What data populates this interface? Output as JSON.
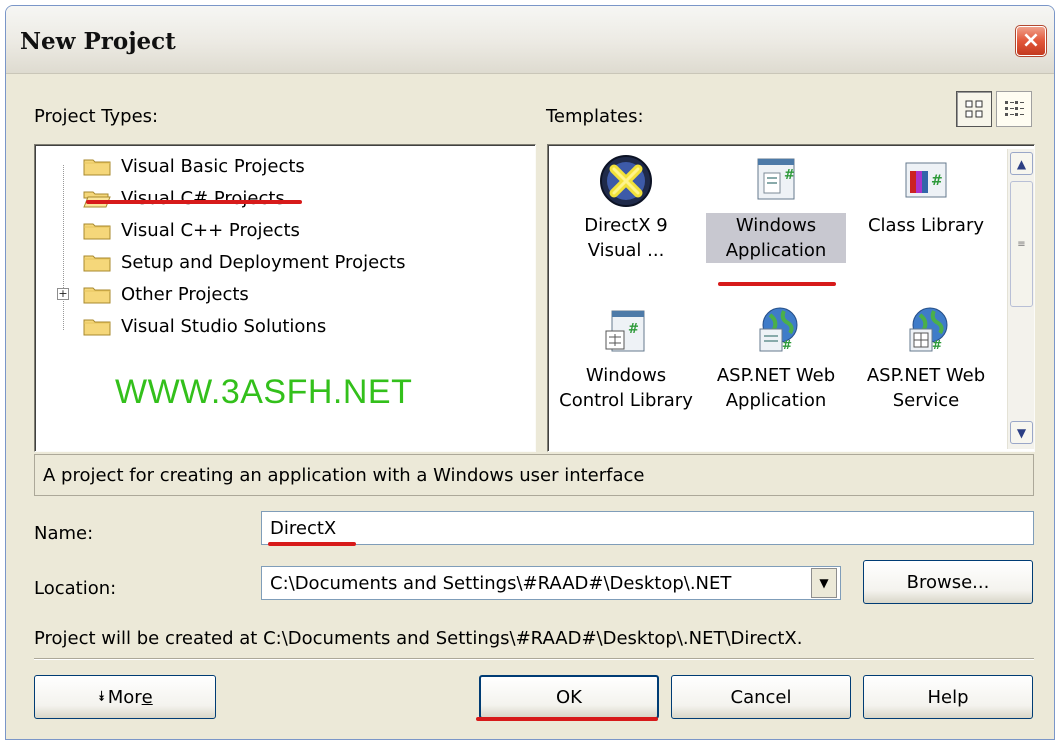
{
  "window": {
    "title": "New Project",
    "close_glyph": "×"
  },
  "project_types": {
    "label": "Project Types:",
    "items": [
      {
        "label": "Visual Basic Projects",
        "icon": "folder-icon",
        "selected": false
      },
      {
        "label": "Visual C# Projects",
        "icon": "folder-open-icon",
        "selected": true
      },
      {
        "label": "Visual C++ Projects",
        "icon": "folder-icon",
        "selected": false
      },
      {
        "label": "Setup and Deployment Projects",
        "icon": "folder-icon",
        "selected": false
      },
      {
        "label": "Other Projects",
        "icon": "folder-icon",
        "selected": false,
        "expander": "+"
      },
      {
        "label": "Visual Studio Solutions",
        "icon": "folder-icon",
        "selected": false
      }
    ],
    "watermark": "WWW.3ASFH.NET"
  },
  "templates": {
    "label": "Templates:",
    "view_buttons": [
      {
        "name": "large-icons-view",
        "icon": "large-icons-view-icon",
        "active": true
      },
      {
        "name": "small-icons-view",
        "icon": "small-icons-view-icon",
        "active": false
      }
    ],
    "items": [
      {
        "line1": "DirectX 9",
        "line2": "Visual ...",
        "icon": "directx-icon",
        "selected": false
      },
      {
        "line1": "Windows",
        "line2": "Application",
        "icon": "windows-application-icon",
        "selected": true
      },
      {
        "line1": "Class Library",
        "line2": "",
        "icon": "class-library-icon",
        "selected": false
      },
      {
        "line1": "Windows",
        "line2": "Control Library",
        "icon": "windows-control-library-icon",
        "selected": false
      },
      {
        "line1": "ASP.NET Web",
        "line2": "Application",
        "icon": "aspnet-web-application-icon",
        "selected": false
      },
      {
        "line1": "ASP.NET Web",
        "line2": "Service",
        "icon": "aspnet-web-service-icon",
        "selected": false
      }
    ],
    "scroll_up": "▲",
    "scroll_down": "▼",
    "scroll_grip": "≡"
  },
  "description": "A project for creating an application with a Windows user interface",
  "name_field": {
    "label": "Name:",
    "value": "DirectX"
  },
  "location_field": {
    "label": "Location:",
    "value": "C:\\Documents and Settings\\#RAAD#\\Desktop\\.NET",
    "dropdown_glyph": "▼"
  },
  "browse_button": "Browse...",
  "created_at": "Project will be created at C:\\Documents and Settings\\#RAAD#\\Desktop\\.NET\\DirectX.",
  "buttons": {
    "more_prefix": "⯯",
    "more": "Mor",
    "more_accel": "e",
    "ok": "OK",
    "cancel": "Cancel",
    "help": "Help"
  },
  "colors": {
    "annotation_red": "#d71a1a",
    "watermark_green": "#33c01b",
    "selection_gray": "#c8c8d0"
  }
}
